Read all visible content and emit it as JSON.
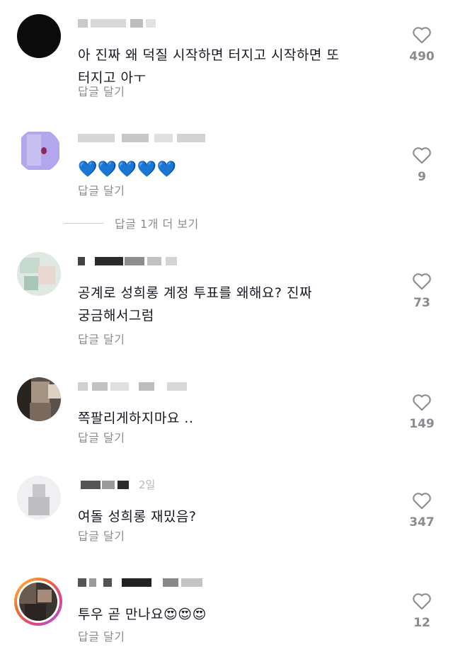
{
  "colors": {
    "text": "#161823",
    "muted": "#8a8b91",
    "heart_blue": "#1e90ff",
    "heart_eyes": "#ffcc33"
  },
  "comments": [
    {
      "text": "아 진짜 왜 덕질 시작하면 터지고 시작하면 또\n터지고 아ㅜ",
      "reply_label": "답글 달기",
      "likes": "490"
    },
    {
      "text": "💙💙💙💙💙",
      "reply_label": "답글 달기",
      "likes": "9",
      "view_replies": "답글 1개 더 보기"
    },
    {
      "text": "공계로 성희롱 계정 투표를 왜해요? 진짜\n궁금해서그럼",
      "reply_label": "답글 달기",
      "likes": "73"
    },
    {
      "text": "쪽팔리게하지마요 ..",
      "reply_label": "답글 달기",
      "likes": "149"
    },
    {
      "time": "2일",
      "text": "여돌 성희롱 재밌음?",
      "reply_label": "답글 달기",
      "likes": "347"
    },
    {
      "text": "투우 곧 만나요😍😍😍",
      "reply_label": "답글 달기",
      "likes": "12"
    }
  ]
}
